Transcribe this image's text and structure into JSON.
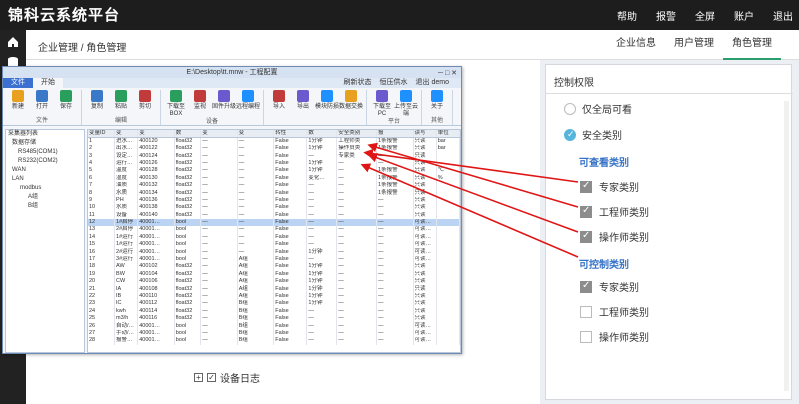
{
  "header": {
    "brand": "锦科云系统平台",
    "nav": [
      "帮助",
      "报警",
      "全屏",
      "账户",
      "退出"
    ]
  },
  "subheader": {
    "breadcrumb": "企业管理 / 角色管理",
    "tabs": [
      "企业信息",
      "用户管理",
      "角色管理"
    ]
  },
  "app": {
    "title": "E:\\Desktop\\tt.mnw - 工程配置",
    "ribbon_tabs": [
      "文件",
      "开始"
    ],
    "ribbon_right": [
      "刷新状态",
      "恒压供水",
      "退出 demo"
    ],
    "groups": [
      {
        "name": "文件",
        "buttons": [
          "新建",
          "打开",
          "保存"
        ]
      },
      {
        "name": "编辑",
        "buttons": [
          "复制",
          "粘贴",
          "剪切"
        ]
      },
      {
        "name": "设备",
        "buttons": [
          "下载至BOX",
          "监视",
          "固件升级",
          "远程编程"
        ]
      },
      {
        "name": "",
        "buttons": [
          "导入",
          "导出",
          "模块防损",
          "数据交换"
        ]
      },
      {
        "name": "平台",
        "buttons": [
          "下载至PC",
          "上传至云端"
        ]
      },
      {
        "name": "其他",
        "buttons": [
          "关于"
        ]
      }
    ],
    "tree": [
      "采集器列表",
      "数据存储",
      "RS485(COM1)",
      "RS232(COM2)",
      "WAN",
      "LAN",
      "modbus",
      "A组",
      "B组"
    ],
    "grid_headers": [
      "变量ID",
      "变",
      "变",
      "数",
      "变",
      "变",
      "转性",
      "数",
      "安全类别",
      "报",
      "读写",
      "单位"
    ],
    "rows": [
      [
        "1",
        "进水…",
        "400120",
        "float32",
        "—",
        "—",
        "False",
        "1分钟",
        "工程师类",
        "1条报警",
        "只读",
        "bar"
      ],
      [
        "2",
        "出水…",
        "400122",
        "float32",
        "—",
        "—",
        "False",
        "1分钟",
        "操作员类",
        "1条报警",
        "只读",
        "bar"
      ],
      [
        "3",
        "设定…",
        "400124",
        "float32",
        "—",
        "—",
        "False",
        "—",
        "专家类",
        "—",
        "只读",
        ""
      ],
      [
        "4",
        "运行…",
        "400126",
        "float32",
        "—",
        "—",
        "False",
        "1分钟",
        "—",
        "—",
        "只读",
        ""
      ],
      [
        "5",
        "温度",
        "400128",
        "float32",
        "—",
        "—",
        "False",
        "1分钟",
        "—",
        "1条报警",
        "只读",
        "℃"
      ],
      [
        "6",
        "湿度",
        "400130",
        "float32",
        "—",
        "—",
        "False",
        "变化…",
        "—",
        "1条报警",
        "只读",
        "%"
      ],
      [
        "7",
        "油质",
        "400132",
        "float32",
        "—",
        "—",
        "False",
        "—",
        "—",
        "1条报警",
        "只读",
        ""
      ],
      [
        "8",
        "水质",
        "400134",
        "float32",
        "—",
        "—",
        "False",
        "—",
        "—",
        "1条报警",
        "只读",
        ""
      ],
      [
        "9",
        "PH",
        "400136",
        "float32",
        "—",
        "—",
        "False",
        "—",
        "—",
        "—",
        "只读",
        ""
      ],
      [
        "10",
        "水质",
        "400138",
        "float32",
        "—",
        "—",
        "False",
        "—",
        "—",
        "—",
        "只读",
        ""
      ],
      [
        "11",
        "设备",
        "400140",
        "float32",
        "—",
        "—",
        "False",
        "—",
        "—",
        "—",
        "只读",
        ""
      ],
      [
        "12",
        "1#启停",
        "40001…",
        "bool",
        "—",
        "—",
        "False",
        "—",
        "—",
        "—",
        "可读…",
        ""
      ],
      [
        "13",
        "2#启停",
        "40001…",
        "bool",
        "—",
        "—",
        "False",
        "—",
        "—",
        "—",
        "可读…",
        ""
      ],
      [
        "14",
        "1#运行",
        "40001…",
        "bool",
        "—",
        "—",
        "False",
        "—",
        "—",
        "—",
        "可读…",
        ""
      ],
      [
        "15",
        "1#运行",
        "40001…",
        "bool",
        "—",
        "—",
        "False",
        "—",
        "—",
        "—",
        "可读…",
        ""
      ],
      [
        "16",
        "2#运行",
        "40001…",
        "bool",
        "—",
        "—",
        "False",
        "1分钟",
        "—",
        "—",
        "可读…",
        ""
      ],
      [
        "17",
        "3#运行",
        "40001…",
        "bool",
        "—",
        "A组",
        "False",
        "—",
        "—",
        "—",
        "可读…",
        ""
      ],
      [
        "18",
        "AW",
        "400102",
        "float32",
        "—",
        "A组",
        "False",
        "1分钟",
        "—",
        "—",
        "只读",
        ""
      ],
      [
        "19",
        "BW",
        "400104",
        "float32",
        "—",
        "A组",
        "False",
        "1分钟",
        "—",
        "—",
        "只读",
        ""
      ],
      [
        "20",
        "CW",
        "400106",
        "float32",
        "—",
        "A组",
        "False",
        "1分钟",
        "—",
        "—",
        "只读",
        ""
      ],
      [
        "21",
        "IA",
        "400108",
        "float32",
        "—",
        "A组",
        "False",
        "1分钟",
        "—",
        "—",
        "只读",
        ""
      ],
      [
        "22",
        "IB",
        "400110",
        "float32",
        "—",
        "A组",
        "False",
        "1分钟",
        "—",
        "—",
        "只读",
        ""
      ],
      [
        "23",
        "IC",
        "400112",
        "float32",
        "—",
        "B组",
        "False",
        "1分钟",
        "—",
        "—",
        "只读",
        ""
      ],
      [
        "24",
        "kwh",
        "400114",
        "float32",
        "—",
        "B组",
        "False",
        "—",
        "—",
        "—",
        "只读",
        ""
      ],
      [
        "25",
        "m3/h",
        "400116",
        "float32",
        "—",
        "B组",
        "False",
        "—",
        "—",
        "—",
        "只读",
        ""
      ],
      [
        "26",
        "自动/…",
        "40001…",
        "bool",
        "—",
        "B组",
        "False",
        "—",
        "—",
        "—",
        "可读…",
        ""
      ],
      [
        "27",
        "手动/…",
        "40001…",
        "bool",
        "—",
        "B组",
        "False",
        "—",
        "—",
        "—",
        "可读…",
        ""
      ],
      [
        "28",
        "报警…",
        "40001…",
        "bool",
        "—",
        "B组",
        "False",
        "—",
        "—",
        "—",
        "可读…",
        ""
      ]
    ]
  },
  "main": {
    "device_log": "设备日志"
  },
  "perm": {
    "title": "控制权限",
    "radios": [
      {
        "label": "仅全局可看",
        "on": false
      },
      {
        "label": "安全类别",
        "on": true
      }
    ],
    "view_title": "可查看类别",
    "view": [
      {
        "label": "专家类别",
        "on": true
      },
      {
        "label": "工程师类别",
        "on": true
      },
      {
        "label": "操作师类别",
        "on": true
      }
    ],
    "ctrl_title": "可控制类别",
    "ctrl": [
      {
        "label": "专家类别",
        "on": true
      },
      {
        "label": "工程师类别",
        "on": false
      },
      {
        "label": "操作师类别",
        "on": false
      }
    ]
  },
  "colors": {
    "accent": "#2a9f6d",
    "blue": "#3773c7",
    "arrow": "#e01515"
  }
}
